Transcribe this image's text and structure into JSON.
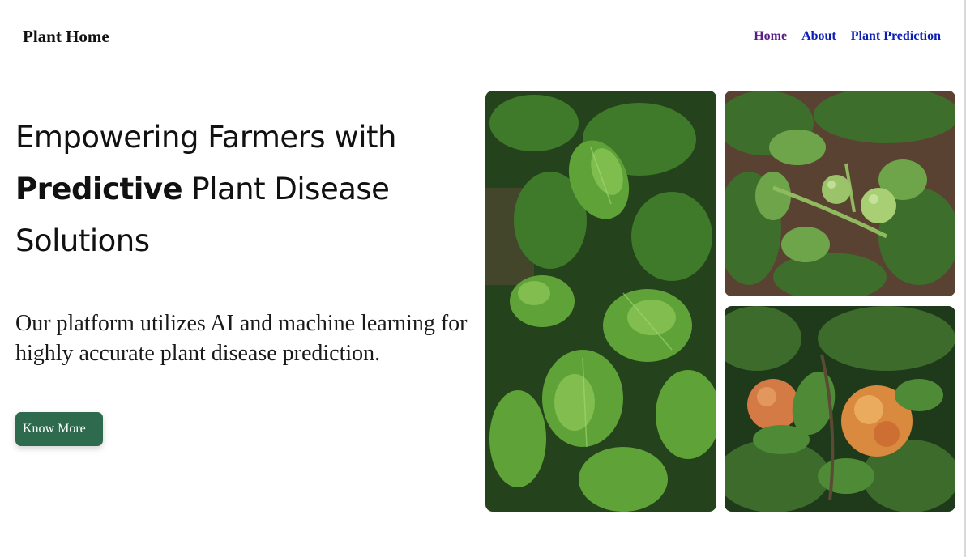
{
  "header": {
    "brand": "Plant Home",
    "nav": [
      {
        "label": "Home",
        "active": true
      },
      {
        "label": "About",
        "active": false
      },
      {
        "label": "Plant Prediction",
        "active": false
      }
    ]
  },
  "hero": {
    "headline_part1": "Empowering Farmers with",
    "headline_bold": "Predictive",
    "headline_part2": "Plant Disease",
    "headline_part3": "Solutions",
    "description": "Our platform utilizes AI and machine learning for highly accurate plant disease prediction.",
    "cta_label": "Know More"
  },
  "gallery": {
    "images": [
      {
        "name": "potato-leaves-photo"
      },
      {
        "name": "tomato-plant-photo"
      },
      {
        "name": "apple-tree-photo"
      }
    ]
  },
  "colors": {
    "cta_bg": "#2e6b4e",
    "nav_link": "#0b1fb8",
    "nav_visited": "#5a1d8a"
  }
}
